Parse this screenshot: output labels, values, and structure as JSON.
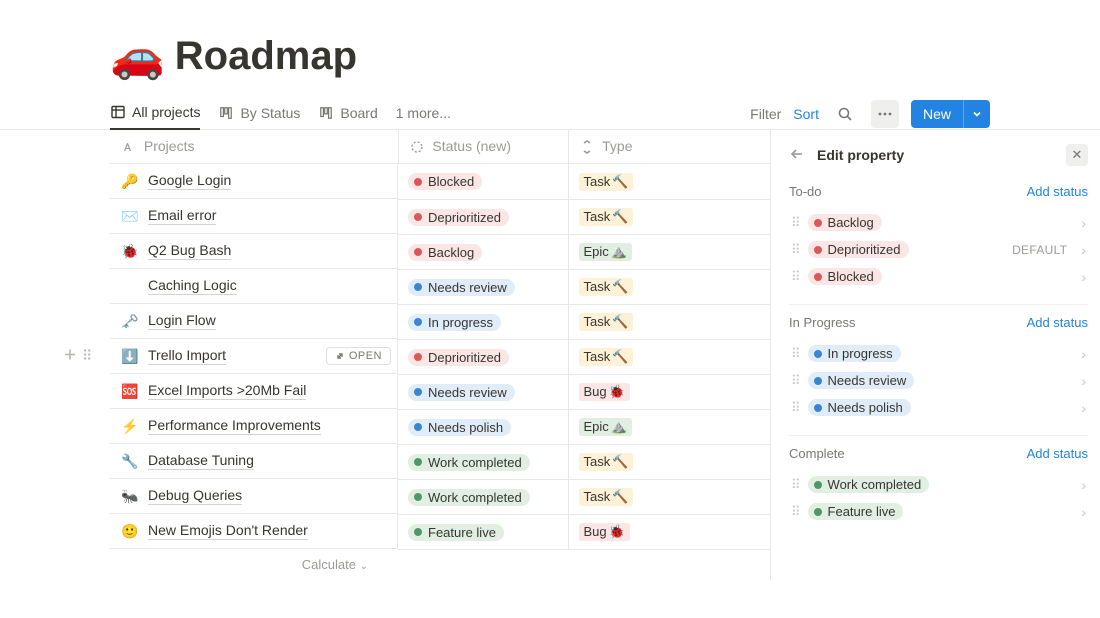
{
  "header": {
    "emoji": "🚗",
    "title": "Roadmap"
  },
  "tabs": {
    "all": "All projects",
    "bystatus": "By Status",
    "board": "Board",
    "more": "1 more..."
  },
  "actions": {
    "filter": "Filter",
    "sort": "Sort",
    "new": "New"
  },
  "columns": {
    "projects": "Projects",
    "status": "Status (new)",
    "type": "Type"
  },
  "rows": [
    {
      "emoji": "🔑",
      "name": "Google Login",
      "status": "Blocked",
      "scolor": "red",
      "type": "Task",
      "temoji": "🔨",
      "tcolor": "task"
    },
    {
      "emoji": "✉️",
      "name": "Email error",
      "status": "Deprioritized",
      "scolor": "red",
      "type": "Task",
      "temoji": "🔨",
      "tcolor": "task"
    },
    {
      "emoji": "🐞",
      "name": "Q2 Bug Bash",
      "status": "Backlog",
      "scolor": "red",
      "type": "Epic",
      "temoji": "⛰️",
      "tcolor": "epic"
    },
    {
      "emoji": "",
      "name": "Caching Logic",
      "status": "Needs review",
      "scolor": "blue",
      "type": "Task",
      "temoji": "🔨",
      "tcolor": "task"
    },
    {
      "emoji": "🗝️",
      "name": "Login Flow",
      "status": "In progress",
      "scolor": "blue",
      "type": "Task",
      "temoji": "🔨",
      "tcolor": "task"
    },
    {
      "emoji": "⬇️",
      "name": "Trello Import",
      "status": "Deprioritized",
      "scolor": "red",
      "type": "Task",
      "temoji": "🔨",
      "tcolor": "task",
      "hover": true
    },
    {
      "emoji": "🆘",
      "name": "Excel Imports >20Mb Fail",
      "status": "Needs review",
      "scolor": "blue",
      "type": "Bug",
      "temoji": "🐞",
      "tcolor": "bug"
    },
    {
      "emoji": "⚡",
      "name": "Performance Improvements",
      "status": "Needs polish",
      "scolor": "blue",
      "type": "Epic",
      "temoji": "⛰️",
      "tcolor": "epic"
    },
    {
      "emoji": "🔧",
      "name": "Database Tuning",
      "status": "Work completed",
      "scolor": "green",
      "type": "Task",
      "temoji": "🔨",
      "tcolor": "task"
    },
    {
      "emoji": "🐜",
      "name": "Debug Queries",
      "status": "Work completed",
      "scolor": "green",
      "type": "Task",
      "temoji": "🔨",
      "tcolor": "task"
    },
    {
      "emoji": "🙂",
      "name": "New Emojis Don't Render",
      "status": "Feature live",
      "scolor": "green",
      "type": "Bug",
      "temoji": "🐞",
      "tcolor": "bug"
    }
  ],
  "calculate": "Calculate",
  "open_label": "OPEN",
  "panel": {
    "title": "Edit property",
    "add": "Add status",
    "default": "DEFAULT",
    "groups": [
      {
        "name": "To-do",
        "statuses": [
          {
            "label": "Backlog",
            "color": "red"
          },
          {
            "label": "Deprioritized",
            "color": "red",
            "default": true
          },
          {
            "label": "Blocked",
            "color": "red"
          }
        ]
      },
      {
        "name": "In Progress",
        "statuses": [
          {
            "label": "In progress",
            "color": "blue"
          },
          {
            "label": "Needs review",
            "color": "blue"
          },
          {
            "label": "Needs polish",
            "color": "blue"
          }
        ]
      },
      {
        "name": "Complete",
        "statuses": [
          {
            "label": "Work completed",
            "color": "green"
          },
          {
            "label": "Feature live",
            "color": "green"
          }
        ]
      }
    ]
  }
}
